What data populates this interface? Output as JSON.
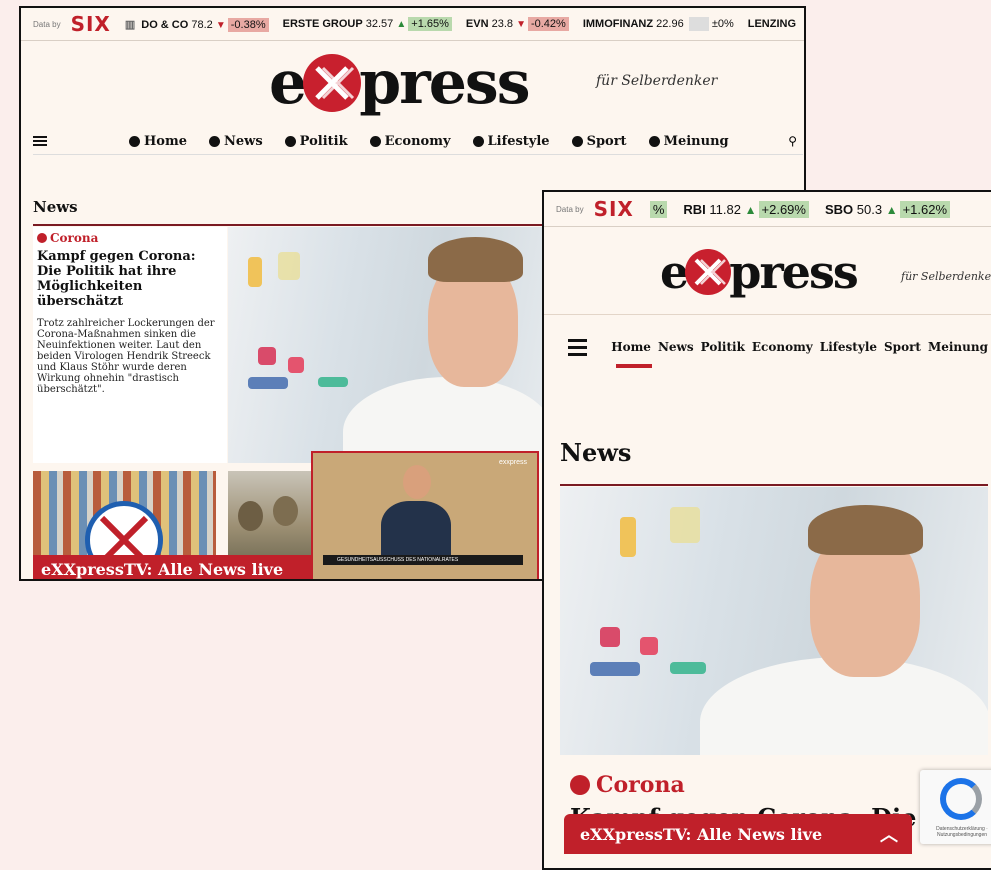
{
  "desktop": {
    "ticker": {
      "data_by": "Data by",
      "six_logo": "SIX",
      "items": [
        {
          "name": "DO & CO",
          "price": "78.2",
          "dir": "down",
          "change": "-0.38%"
        },
        {
          "name": "ERSTE GROUP",
          "price": "32.57",
          "dir": "up",
          "change": "+1.65%"
        },
        {
          "name": "EVN",
          "price": "23.8",
          "dir": "down",
          "change": "-0.42%"
        },
        {
          "name": "IMMOFINANZ",
          "price": "22.96",
          "dir": "flat",
          "change": "±0%"
        },
        {
          "name": "LENZING",
          "price": "",
          "dir": "none",
          "change": ""
        }
      ]
    },
    "logo": "exxpress",
    "tagline": "für Selberdenker",
    "nav": [
      "Home",
      "News",
      "Politik",
      "Economy",
      "Lifestyle",
      "Sport",
      "Meinung"
    ],
    "section_title": "News",
    "article": {
      "kicker": "Corona",
      "headline": "Kampf gegen Corona: Die Politik hat ihre Möglichkeiten überschätzt",
      "teaser": "Trotz zahlreicher Lockerungen der Corona-Maßnahmen sinken die Neuinfektionen weiter. Laut den beiden Virologen Hendrik Streeck und Klaus Stöhr wurde deren Wirkung ohnehin \"drastisch überschätzt\"."
    },
    "tv_bar": "eXXpressTV: Alle News live",
    "tv_lower_third": "GESUNDHEITSAUSSCHUSS DES NATIONALRATES",
    "tv_logo": "exxpress"
  },
  "mobile": {
    "ticker": {
      "data_by": "Data by",
      "six_logo": "SIX",
      "items": [
        {
          "name": "",
          "price": "",
          "dir": "none",
          "change": "%"
        },
        {
          "name": "RBI",
          "price": "11.82",
          "dir": "up",
          "change": "+2.69%"
        },
        {
          "name": "SBO",
          "price": "50.3",
          "dir": "up",
          "change": "+1.62%"
        }
      ]
    },
    "logo": "exxpress",
    "tagline": "für Selberdenker",
    "nav": [
      "Home",
      "News",
      "Politik",
      "Economy",
      "Lifestyle",
      "Sport",
      "Meinung"
    ],
    "section_title": "News",
    "article": {
      "kicker": "Corona",
      "headline": "Kampf gegen Corona: Die Politik hat ihre Möglichkeiten überschätzt"
    },
    "tv_bar": "eXXpressTV: Alle News live",
    "recaptcha": "Datenschutzerklärung · Nutzungsbedingungen"
  },
  "colors": {
    "brand_red": "#c0202a",
    "page_bg": "#fdf6ef",
    "outer_bg": "#fbeeec",
    "up": "#b9d9ad",
    "down": "#e8a9a3"
  }
}
